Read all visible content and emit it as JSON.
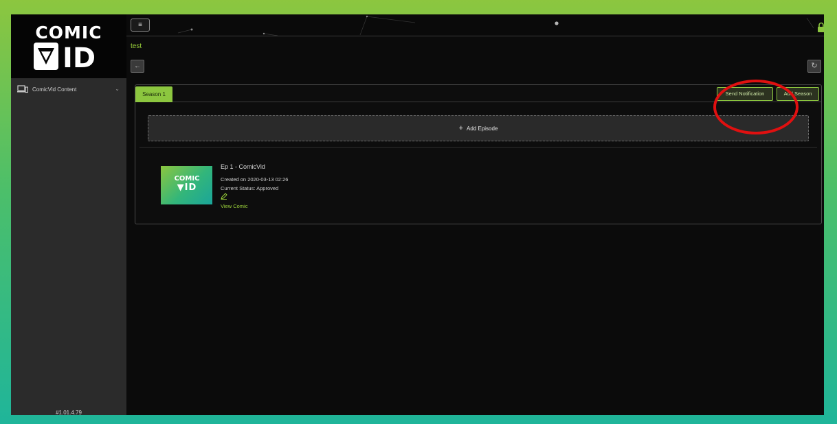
{
  "app": {
    "logo_top": "COMIC",
    "logo_bottom": "ID"
  },
  "sidebar": {
    "items": [
      {
        "label": "ComicVid Content",
        "icon": "devices-icon"
      }
    ],
    "version": "#1.01.4.79"
  },
  "header": {
    "breadcrumb": "test"
  },
  "season_panel": {
    "tabs": [
      {
        "label": "Season 1",
        "active": true
      }
    ],
    "send_notification_label": "Send Notification",
    "add_season_label": "Add Season",
    "add_episode_label": "Add Episode"
  },
  "episodes": [
    {
      "title": "Ep 1 - ComicVid",
      "created": "Created on 2020-03-13 02:26",
      "status": "Current Status: Approved",
      "view_label": "View Comic",
      "thumb_top": "COMIC",
      "thumb_bottom": "ID"
    }
  ],
  "colors": {
    "accent": "#8cc63f",
    "highlight": "#e01010",
    "background": "#0b0b0b",
    "sidebar": "#2b2b2b"
  }
}
